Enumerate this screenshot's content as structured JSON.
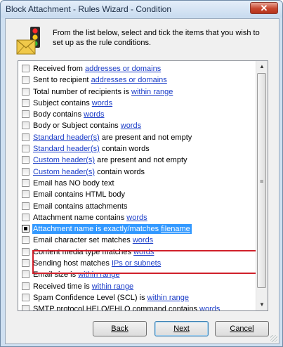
{
  "window": {
    "title": "Block Attachment - Rules Wizard - Condition",
    "close_glyph": "✕"
  },
  "header": {
    "icon": "traffic-light-envelope-icon",
    "instruction": "From the list below, select and tick the items that you wish to set up as the rule conditions."
  },
  "conditions": [
    {
      "text": "Received from ",
      "link": "addresses or domains",
      "after": "",
      "checked": false
    },
    {
      "text": "Sent to recipient ",
      "link": "addresses or domains",
      "after": "",
      "checked": false
    },
    {
      "text": "Total number of recipients is ",
      "link": "within range",
      "after": "",
      "checked": false
    },
    {
      "text": "Subject contains ",
      "link": "words",
      "after": "",
      "checked": false
    },
    {
      "text": "Body contains ",
      "link": "words",
      "after": "",
      "checked": false
    },
    {
      "text": "Body or Subject contains ",
      "link": "words",
      "after": "",
      "checked": false
    },
    {
      "text": "",
      "link": "Standard header(s)",
      "after": " are present and not empty",
      "checked": false
    },
    {
      "text": "",
      "link": "Standard header(s)",
      "after": " contain words",
      "checked": false
    },
    {
      "text": "",
      "link": "Custom header(s)",
      "after": " are present and not empty",
      "checked": false
    },
    {
      "text": "",
      "link": "Custom header(s)",
      "after": " contain words",
      "checked": false
    },
    {
      "text": "Email has NO body text",
      "link": "",
      "after": "",
      "checked": false
    },
    {
      "text": "Email contains HTML body",
      "link": "",
      "after": "",
      "checked": false
    },
    {
      "text": "Email contains attachments",
      "link": "",
      "after": "",
      "checked": false
    },
    {
      "text": "Attachment name contains ",
      "link": "words",
      "after": "",
      "checked": false
    },
    {
      "text": "Attachment name is exactly/matches ",
      "link": "filename",
      "after": "",
      "checked": true,
      "selected": true
    },
    {
      "text": "Email character set matches ",
      "link": "words",
      "after": "",
      "checked": false
    },
    {
      "text": "Content media type matches ",
      "link": "words",
      "after": "",
      "checked": false
    },
    {
      "text": "Sending host matches ",
      "link": "IPs or subnets",
      "after": "",
      "checked": false
    },
    {
      "text": "Email size is ",
      "link": "within range",
      "after": "",
      "checked": false
    },
    {
      "text": "Received time is ",
      "link": "within range",
      "after": "",
      "checked": false
    },
    {
      "text": "Spam Confidence Level (SCL) is ",
      "link": "within range",
      "after": "",
      "checked": false
    },
    {
      "text": "SMTP protocol HELO/EHLO command contains ",
      "link": "words",
      "after": "",
      "checked": false
    }
  ],
  "buttons": {
    "back": "Back",
    "next": "Next",
    "cancel": "Cancel"
  },
  "colors": {
    "link": "#1a3cc7",
    "selection": "#3399ff",
    "highlight_box": "#d0202a",
    "close_button": "#c7462e"
  }
}
